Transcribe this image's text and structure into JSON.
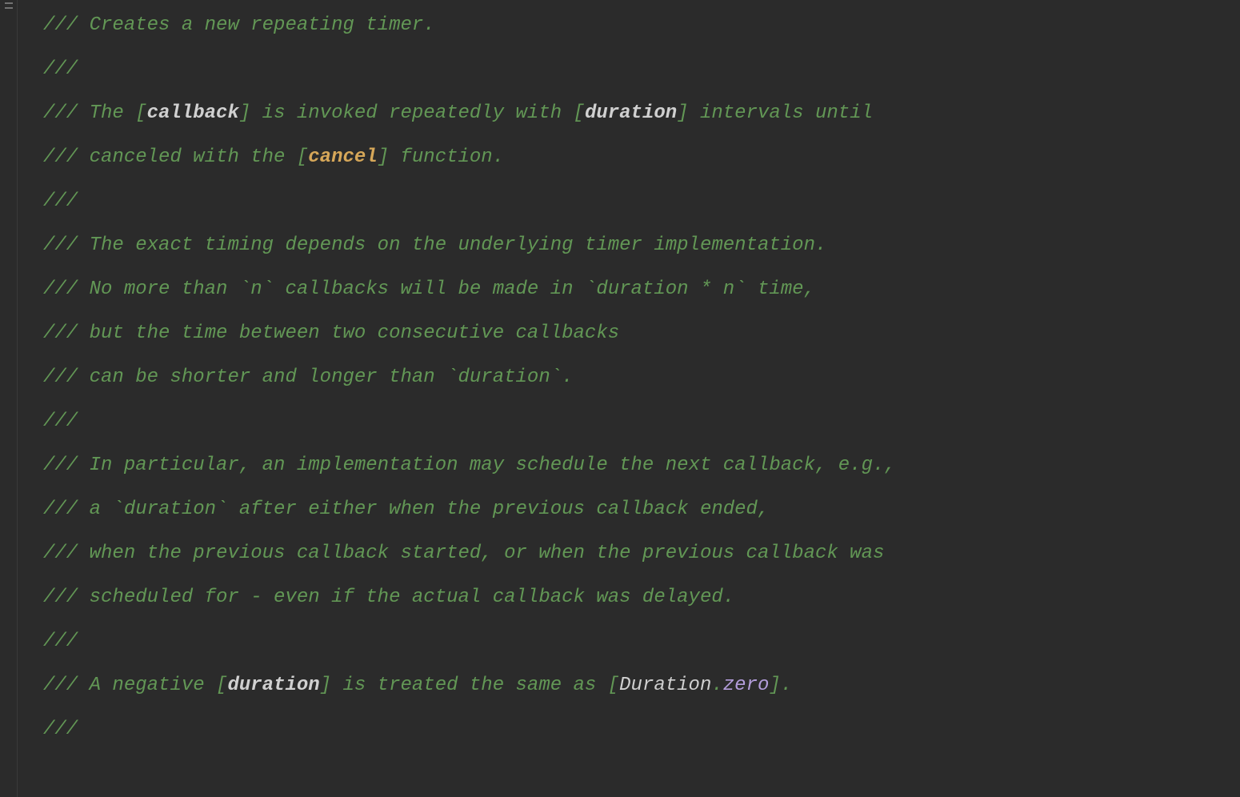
{
  "code": {
    "comment_prefix": "///",
    "lines": {
      "l1": " Creates a new repeating timer.",
      "l3a": " The [",
      "l3_ref1": "callback",
      "l3b": "] is invoked repeatedly with [",
      "l3_ref2": "duration",
      "l3c": "] intervals until",
      "l4a": " canceled with the [",
      "l4_ref1": "cancel",
      "l4b": "] function.",
      "l6": " The exact timing depends on the underlying timer implementation.",
      "l7": " No more than `n` callbacks will be made in `duration * n` time,",
      "l8": " but the time between two consecutive callbacks",
      "l9": " can be shorter and longer than `duration`.",
      "l11": " In particular, an implementation may schedule the next callback, e.g.,",
      "l12": " a `duration` after either when the previous callback ended,",
      "l13": " when the previous callback started, or when the previous callback was",
      "l14": " scheduled for - even if the actual callback was delayed.",
      "l16a": " A negative [",
      "l16_ref1": "duration",
      "l16b": "] is treated the same as [",
      "l16_ref2": "Duration",
      "l16_dot": ".",
      "l16_ref3": "zero",
      "l16c": "]."
    }
  }
}
